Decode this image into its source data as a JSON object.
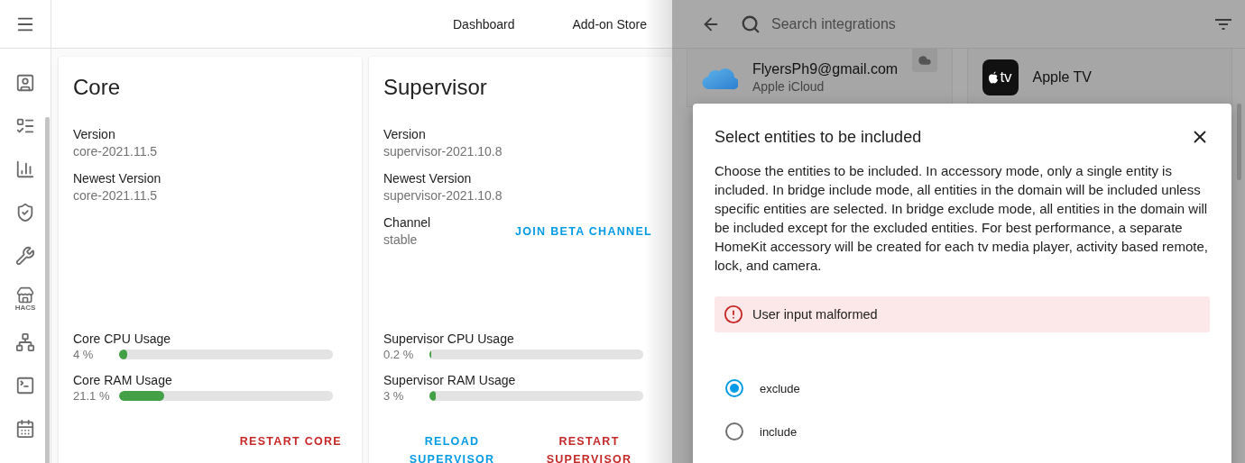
{
  "topbar": {
    "tabs": [
      {
        "label": "Dashboard"
      },
      {
        "label": "Add-on Store"
      }
    ]
  },
  "sidebar": {
    "store_label": "HACS"
  },
  "cards": [
    {
      "title": "Core",
      "fields": [
        {
          "label": "Version",
          "value": "core-2021.11.5"
        },
        {
          "label": "Newest Version",
          "value": "core-2021.11.5"
        }
      ],
      "gauges": [
        {
          "label": "Core CPU Usage",
          "reading": "4 %",
          "level": 0.04
        },
        {
          "label": "Core RAM Usage",
          "reading": "21.1 %",
          "level": 0.211
        }
      ],
      "buttons": [
        {
          "label": "RESTART CORE",
          "kind": "danger"
        }
      ]
    },
    {
      "title": "Supervisor",
      "fields": [
        {
          "label": "Version",
          "value": "supervisor-2021.10.8"
        },
        {
          "label": "Newest Version",
          "value": "supervisor-2021.10.8"
        },
        {
          "label": "Channel",
          "value": "stable",
          "action": "JOIN BETA CHANNEL"
        }
      ],
      "gauges": [
        {
          "label": "Supervisor CPU Usage",
          "reading": "0.2 %",
          "level": 0.002
        },
        {
          "label": "Supervisor RAM Usage",
          "reading": "3 %",
          "level": 0.03
        }
      ],
      "buttons": [
        {
          "label": "RELOAD SUPERVISOR",
          "kind": "primary"
        },
        {
          "label": "RESTART SUPERVISOR",
          "kind": "danger"
        }
      ]
    }
  ],
  "integrations": {
    "search": {
      "placeholder": "Search integrations"
    },
    "cards": [
      {
        "kind": "icloud",
        "title": "FlyersPh9@gmail.com",
        "subtitle": "Apple iCloud",
        "cloud": true
      },
      {
        "kind": "appletv",
        "title": "Apple TV",
        "logo_text": "tv",
        "cloud": false
      }
    ]
  },
  "dialog": {
    "title": "Select entities to be included",
    "description": "Choose the entities to be included. In accessory mode, only a single entity is included. In bridge include mode, all entities in the domain will be included unless specific entities are selected. In bridge exclude mode, all entities in the domain will be included except for the excluded entities. For best performance, a separate HomeKit accessory will be created for each tv media player, activity based remote, lock, and camera.",
    "error": "User input malformed",
    "options": [
      {
        "label": "exclude",
        "selected": true
      },
      {
        "label": "include",
        "selected": false
      }
    ]
  }
}
